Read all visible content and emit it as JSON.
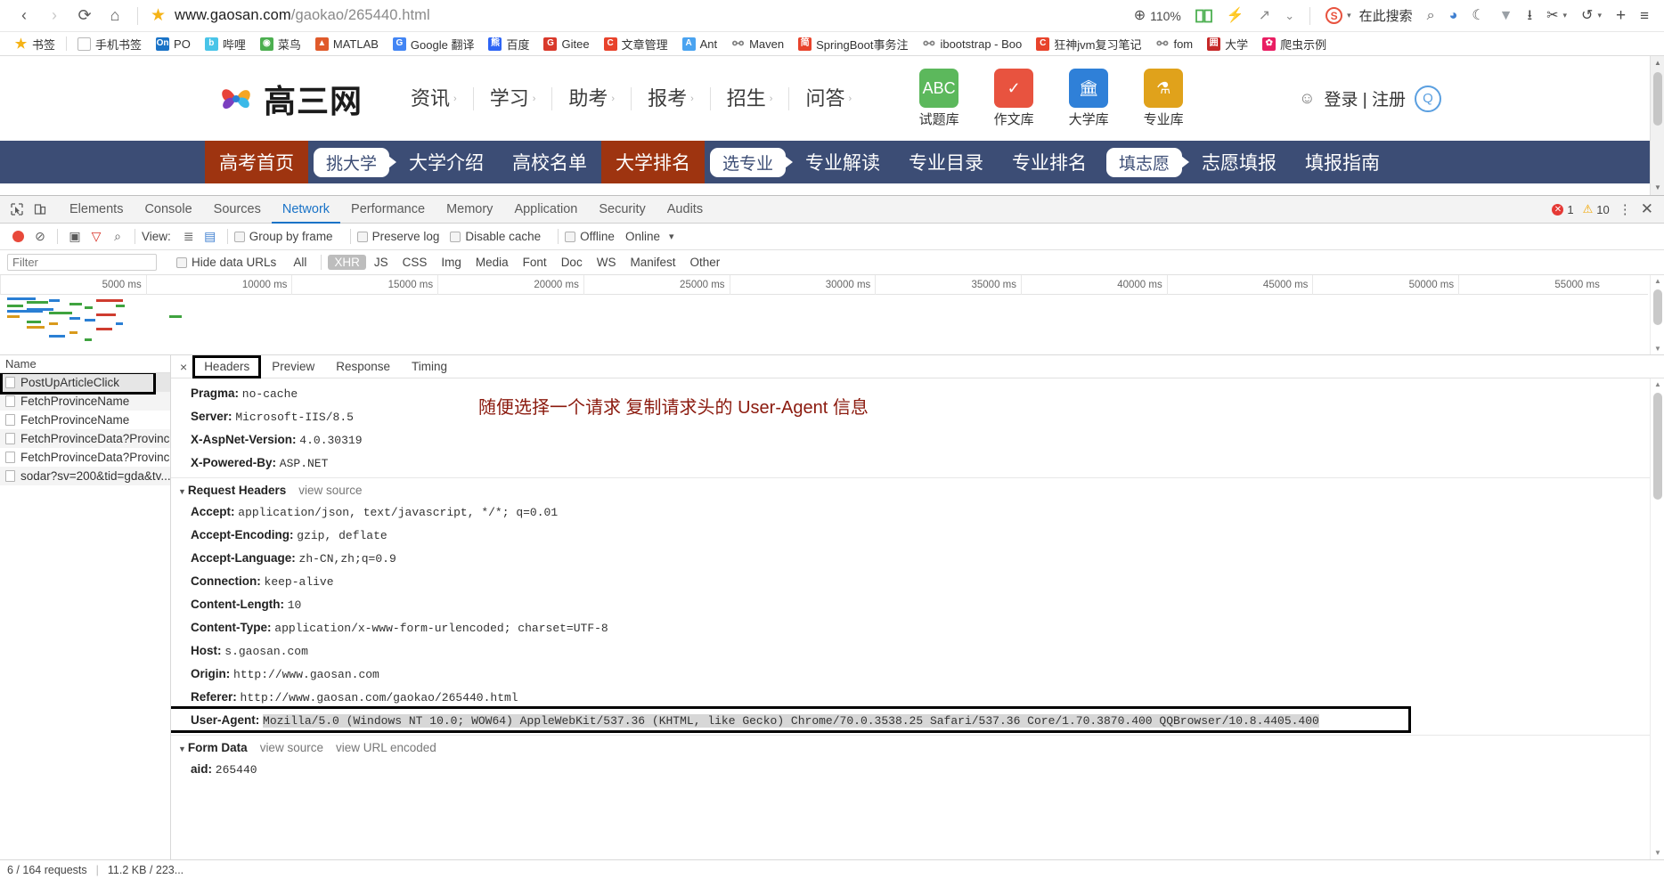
{
  "browser": {
    "url_main": "www.gaosan.com",
    "url_path": "/gaokao/265440.html",
    "back_icon": "‹",
    "forward_icon": "›",
    "reload_icon": "⟳",
    "home_icon": "⌂",
    "star_icon": "★",
    "zoom_label": "110%",
    "zoom_icon": "⊕",
    "reader_icon": "book-icon",
    "lightning_icon": "⚡",
    "share_icon": "↗",
    "chevron_icon": "⌄",
    "sogou_badge": "S",
    "search_placeholder": "在此搜索",
    "right_icons": [
      {
        "name": "search-icon",
        "glyph": "⌕"
      },
      {
        "name": "translate-icon",
        "glyph": "◕"
      },
      {
        "name": "night-mode-icon",
        "glyph": "☾"
      },
      {
        "name": "video-icon",
        "glyph": "▼"
      },
      {
        "name": "download-icon",
        "glyph": "⭳"
      },
      {
        "name": "screenshot-scissors-icon",
        "glyph": "✂"
      },
      {
        "name": "undo-icon",
        "glyph": "↺"
      },
      {
        "name": "add-icon",
        "glyph": "+"
      },
      {
        "name": "menu-icon",
        "glyph": "≡"
      }
    ]
  },
  "bookmarks": [
    {
      "label": "书签",
      "icon": "star",
      "color": "#f5b316"
    },
    {
      "label": "手机书签",
      "icon": "blank",
      "color": "#ffffff"
    },
    {
      "label": "PO",
      "icon": "text",
      "text": "On",
      "color": "#1a73c7"
    },
    {
      "label": "哔哩",
      "icon": "text",
      "text": "b",
      "color": "#48c4e8"
    },
    {
      "label": "菜鸟",
      "icon": "text",
      "text": "◉",
      "color": "#4caf50"
    },
    {
      "label": "MATLAB",
      "icon": "text",
      "text": "▲",
      "color": "#e05a2b"
    },
    {
      "label": "Google 翻译",
      "icon": "text",
      "text": "G",
      "color": "#4285f4"
    },
    {
      "label": "百度",
      "icon": "text",
      "text": "熊",
      "color": "#2d64f5"
    },
    {
      "label": "Gitee",
      "icon": "text",
      "text": "G",
      "color": "#d9392b"
    },
    {
      "label": "文章管理",
      "icon": "text",
      "text": "C",
      "color": "#e8432c"
    },
    {
      "label": "Ant",
      "icon": "text",
      "text": "A",
      "color": "#4aa3f0"
    },
    {
      "label": "Maven",
      "icon": "globe",
      "color": "#808080"
    },
    {
      "label": "SpringBoot事务注",
      "icon": "text",
      "text": "简",
      "color": "#e8432c"
    },
    {
      "label": "ibootstrap - Boo",
      "icon": "globe",
      "color": "#808080"
    },
    {
      "label": "狂神jvm复习笔记",
      "icon": "text",
      "text": "C",
      "color": "#e8432c"
    },
    {
      "label": "fom",
      "icon": "globe",
      "color": "#808080"
    },
    {
      "label": "大学",
      "icon": "text",
      "text": "囲",
      "color": "#c62828"
    },
    {
      "label": "爬虫示例",
      "icon": "text",
      "text": "✿",
      "color": "#e91e63"
    }
  ],
  "site": {
    "logo_text": "高三网",
    "nav": [
      {
        "label": "资讯"
      },
      {
        "label": "学习"
      },
      {
        "label": "助考"
      },
      {
        "label": "报考"
      },
      {
        "label": "招生"
      },
      {
        "label": "问答"
      }
    ],
    "nav_arrow": "›",
    "quick_links": [
      {
        "label": "试题库",
        "glyph": "ABC",
        "color": "#5cb85c"
      },
      {
        "label": "作文库",
        "glyph": "✓",
        "color": "#e8533f"
      },
      {
        "label": "大学库",
        "glyph": "🏛",
        "color": "#2f80d8"
      },
      {
        "label": "专业库",
        "glyph": "⚗",
        "color": "#e0a21b"
      }
    ],
    "login": "登录 | 注册",
    "person_icon": "person-icon",
    "qq_icon": "qq-icon",
    "subnav": [
      {
        "label": "高考首页",
        "type": "accent"
      },
      {
        "label": "挑大学",
        "type": "pill"
      },
      {
        "label": "大学介绍",
        "type": "plain"
      },
      {
        "label": "高校名单",
        "type": "plain"
      },
      {
        "label": "大学排名",
        "type": "accent"
      },
      {
        "label": "选专业",
        "type": "pill"
      },
      {
        "label": "专业解读",
        "type": "plain"
      },
      {
        "label": "专业目录",
        "type": "plain"
      },
      {
        "label": "专业排名",
        "type": "plain"
      },
      {
        "label": "填志愿",
        "type": "pill"
      },
      {
        "label": "志愿填报",
        "type": "plain"
      },
      {
        "label": "填报指南",
        "type": "plain"
      }
    ],
    "colors": {
      "subnav_bg": "#3c4d75",
      "accent": "#9e3410"
    }
  },
  "devtools": {
    "tabs": [
      "Elements",
      "Console",
      "Sources",
      "Network",
      "Performance",
      "Memory",
      "Application",
      "Security",
      "Audits"
    ],
    "active_tab": "Network",
    "inspect_icon": "inspect-cursor-icon",
    "device_icon": "device-toolbar-icon",
    "error_count": "1",
    "warning_count": "10",
    "kebab_icon": "⋮",
    "close_icon": "✕",
    "toolbar": {
      "record_icon": "record-icon",
      "clear_icon": "⊘",
      "camera_icon": "▣",
      "filter_icon": "filter-funnel-icon",
      "search_icon": "⌕",
      "view_label": "View:",
      "list_view_icon": "≣",
      "waterfall_view_icon": "▤",
      "group_by_frame": "Group by frame",
      "preserve_log": "Preserve log",
      "disable_cache": "Disable cache",
      "offline": "Offline",
      "online": "Online",
      "throttle_caret": "▾"
    },
    "filterbar": {
      "filter_placeholder": "Filter",
      "hide_data_urls": "Hide data URLs",
      "types": [
        "All",
        "XHR",
        "JS",
        "CSS",
        "Img",
        "Media",
        "Font",
        "Doc",
        "WS",
        "Manifest",
        "Other"
      ],
      "active_type": "XHR"
    },
    "overview_ticks": [
      "5000 ms",
      "10000 ms",
      "15000 ms",
      "20000 ms",
      "25000 ms",
      "30000 ms",
      "35000 ms",
      "40000 ms",
      "45000 ms",
      "50000 ms",
      "55000 ms"
    ],
    "requests_header": "Name",
    "requests": [
      {
        "name": "PostUpArticleClick",
        "selected": true
      },
      {
        "name": "FetchProvinceName",
        "selected": false
      },
      {
        "name": "FetchProvinceName",
        "selected": false
      },
      {
        "name": "FetchProvinceData?Provinc...",
        "selected": false
      },
      {
        "name": "FetchProvinceData?Provinc...",
        "selected": false
      },
      {
        "name": "sodar?sv=200&tid=gda&tv...",
        "selected": false
      }
    ],
    "detail_tabs": [
      "Headers",
      "Preview",
      "Response",
      "Timing"
    ],
    "detail_active_tab": "Headers",
    "detail_close": "×",
    "response_headers": [
      {
        "key": "Pragma:",
        "value": "no-cache"
      },
      {
        "key": "Server:",
        "value": "Microsoft-IIS/8.5"
      },
      {
        "key": "X-AspNet-Version:",
        "value": "4.0.30319"
      },
      {
        "key": "X-Powered-By:",
        "value": "ASP.NET"
      }
    ],
    "request_headers_title": "Request Headers",
    "view_source": "view source",
    "request_headers": [
      {
        "key": "Accept:",
        "value": "application/json, text/javascript, */*; q=0.01"
      },
      {
        "key": "Accept-Encoding:",
        "value": "gzip, deflate"
      },
      {
        "key": "Accept-Language:",
        "value": "zh-CN,zh;q=0.9"
      },
      {
        "key": "Connection:",
        "value": "keep-alive"
      },
      {
        "key": "Content-Length:",
        "value": "10"
      },
      {
        "key": "Content-Type:",
        "value": "application/x-www-form-urlencoded; charset=UTF-8"
      },
      {
        "key": "Host:",
        "value": "s.gaosan.com"
      },
      {
        "key": "Origin:",
        "value": "http://www.gaosan.com"
      },
      {
        "key": "Referer:",
        "value": "http://www.gaosan.com/gaokao/265440.html"
      }
    ],
    "user_agent": {
      "key": "User-Agent:",
      "value": "Mozilla/5.0 (Windows NT 10.0; WOW64) AppleWebKit/537.36 (KHTML, like Gecko) Chrome/70.0.3538.25 Safari/537.36 Core/1.70.3870.400 QQBrowser/10.8.4405.400"
    },
    "form_data_title": "Form Data",
    "view_url_encoded": "view URL encoded",
    "form_data": [
      {
        "key": "aid:",
        "value": "265440"
      }
    ],
    "annotation": "随便选择一个请求 复制请求头的 User-Agent 信息",
    "annotation_color": "#8b1a0e",
    "status_bar": {
      "requests": "6 / 164 requests",
      "transferred": "11.2 KB / 223..."
    }
  }
}
